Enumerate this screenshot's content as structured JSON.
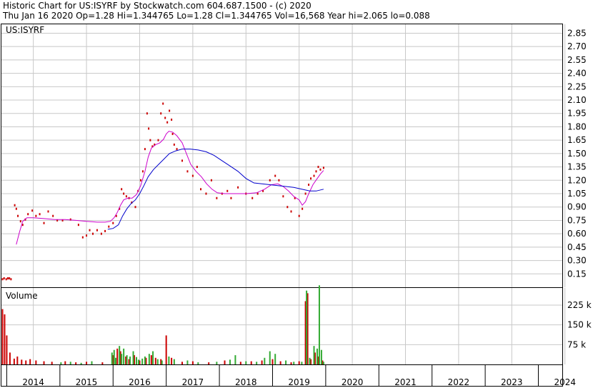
{
  "header": {
    "line1": "Historic Chart for US:ISYRF by Stockwatch.com 604.687.1500 - (c) 2020",
    "line2": "Thu Jan 16 2020  Op=1.28  Hi=1.344765  Lo=1.28  Cl=1.344765  Vol=16,568  Year hi=2.065  lo=0.088"
  },
  "colors": {
    "price": "#cc0000",
    "ma_short": "#cc00cc",
    "ma_long": "#0000cc",
    "vol_up": "#33aa33",
    "vol_down": "#cc0000",
    "grid": "#c8c8c8"
  },
  "chart_data": [
    {
      "type": "line",
      "title": "US:ISYRF",
      "x_tick_labels": [
        "2014",
        "2015",
        "2016",
        "2017",
        "2018",
        "2019",
        "2020",
        "2021",
        "2022",
        "2023",
        "2024"
      ],
      "y_ticks": [
        "0.15",
        "0.30",
        "0.45",
        "0.60",
        "0.75",
        "0.90",
        "1.05",
        "1.20",
        "1.35",
        "1.50",
        "1.65",
        "1.80",
        "1.95",
        "2.10",
        "2.25",
        "2.40",
        "2.55",
        "2.70",
        "2.85"
      ],
      "ylim": [
        0,
        2.95
      ],
      "xlim": [
        2013.9,
        2024.45
      ],
      "grid": true,
      "series": [
        {
          "role": "price",
          "points": [
            [
              2013.92,
              0.09
            ],
            [
              2013.95,
              0.1
            ],
            [
              2013.99,
              0.09
            ],
            [
              2014.02,
              0.1
            ],
            [
              2014.05,
              0.1
            ],
            [
              2014.08,
              0.09
            ],
            [
              2014.15,
              0.92
            ],
            [
              2014.18,
              0.88
            ],
            [
              2014.21,
              0.8
            ],
            [
              2014.26,
              0.74
            ],
            [
              2014.3,
              0.7
            ],
            [
              2014.35,
              0.76
            ],
            [
              2014.4,
              0.82
            ],
            [
              2014.48,
              0.86
            ],
            [
              2014.55,
              0.8
            ],
            [
              2014.62,
              0.82
            ],
            [
              2014.7,
              0.72
            ],
            [
              2014.78,
              0.85
            ],
            [
              2014.87,
              0.8
            ],
            [
              2014.95,
              0.75
            ],
            [
              2015.05,
              0.75
            ],
            [
              2015.2,
              0.76
            ],
            [
              2015.35,
              0.7
            ],
            [
              2015.43,
              0.56
            ],
            [
              2015.5,
              0.58
            ],
            [
              2015.56,
              0.64
            ],
            [
              2015.62,
              0.6
            ],
            [
              2015.7,
              0.64
            ],
            [
              2015.78,
              0.6
            ],
            [
              2015.85,
              0.63
            ],
            [
              2015.92,
              0.68
            ],
            [
              2016.0,
              0.72
            ],
            [
              2016.06,
              0.8
            ],
            [
              2016.12,
              0.88
            ],
            [
              2016.16,
              1.1
            ],
            [
              2016.2,
              1.05
            ],
            [
              2016.25,
              1.02
            ],
            [
              2016.3,
              1.0
            ],
            [
              2016.35,
              0.95
            ],
            [
              2016.42,
              0.9
            ],
            [
              2016.47,
              1.08
            ],
            [
              2016.52,
              1.2
            ],
            [
              2016.56,
              1.3
            ],
            [
              2016.6,
              1.55
            ],
            [
              2016.64,
              1.95
            ],
            [
              2016.67,
              1.78
            ],
            [
              2016.7,
              1.65
            ],
            [
              2016.74,
              1.58
            ],
            [
              2016.78,
              1.6
            ],
            [
              2016.85,
              1.65
            ],
            [
              2016.9,
              1.95
            ],
            [
              2016.94,
              2.06
            ],
            [
              2016.98,
              1.9
            ],
            [
              2017.02,
              1.85
            ],
            [
              2017.06,
              1.98
            ],
            [
              2017.1,
              1.88
            ],
            [
              2017.12,
              1.72
            ],
            [
              2017.15,
              1.6
            ],
            [
              2017.2,
              1.55
            ],
            [
              2017.3,
              1.42
            ],
            [
              2017.4,
              1.3
            ],
            [
              2017.5,
              1.25
            ],
            [
              2017.58,
              1.35
            ],
            [
              2017.65,
              1.1
            ],
            [
              2017.75,
              1.05
            ],
            [
              2017.85,
              1.2
            ],
            [
              2017.95,
              1.0
            ],
            [
              2018.05,
              1.05
            ],
            [
              2018.15,
              1.08
            ],
            [
              2018.22,
              1.0
            ],
            [
              2018.35,
              1.12
            ],
            [
              2018.5,
              1.05
            ],
            [
              2018.62,
              1.0
            ],
            [
              2018.72,
              1.05
            ],
            [
              2018.82,
              1.08
            ],
            [
              2018.95,
              1.2
            ],
            [
              2019.05,
              1.25
            ],
            [
              2019.12,
              1.2
            ],
            [
              2019.2,
              1.02
            ],
            [
              2019.28,
              0.9
            ],
            [
              2019.35,
              0.85
            ],
            [
              2019.42,
              1.0
            ],
            [
              2019.5,
              0.8
            ],
            [
              2019.56,
              0.88
            ],
            [
              2019.62,
              1.05
            ],
            [
              2019.68,
              1.15
            ],
            [
              2019.72,
              1.22
            ],
            [
              2019.78,
              1.25
            ],
            [
              2019.82,
              1.3
            ],
            [
              2019.86,
              1.35
            ],
            [
              2019.9,
              1.32
            ],
            [
              2019.96,
              1.34
            ]
          ]
        },
        {
          "role": "ma_short",
          "points": [
            [
              2014.18,
              0.48
            ],
            [
              2014.24,
              0.62
            ],
            [
              2014.3,
              0.74
            ],
            [
              2014.38,
              0.78
            ],
            [
              2014.5,
              0.78
            ],
            [
              2014.7,
              0.77
            ],
            [
              2014.9,
              0.76
            ],
            [
              2015.1,
              0.76
            ],
            [
              2015.3,
              0.75
            ],
            [
              2015.5,
              0.74
            ],
            [
              2015.7,
              0.73
            ],
            [
              2015.85,
              0.73
            ],
            [
              2015.95,
              0.74
            ],
            [
              2016.02,
              0.78
            ],
            [
              2016.08,
              0.84
            ],
            [
              2016.14,
              0.92
            ],
            [
              2016.2,
              0.98
            ],
            [
              2016.28,
              1.0
            ],
            [
              2016.36,
              1.0
            ],
            [
              2016.44,
              1.04
            ],
            [
              2016.52,
              1.14
            ],
            [
              2016.6,
              1.3
            ],
            [
              2016.66,
              1.46
            ],
            [
              2016.72,
              1.56
            ],
            [
              2016.8,
              1.6
            ],
            [
              2016.88,
              1.62
            ],
            [
              2016.95,
              1.66
            ],
            [
              2017.0,
              1.72
            ],
            [
              2017.05,
              1.75
            ],
            [
              2017.12,
              1.74
            ],
            [
              2017.2,
              1.7
            ],
            [
              2017.3,
              1.62
            ],
            [
              2017.38,
              1.5
            ],
            [
              2017.46,
              1.38
            ],
            [
              2017.56,
              1.3
            ],
            [
              2017.66,
              1.24
            ],
            [
              2017.76,
              1.16
            ],
            [
              2017.86,
              1.1
            ],
            [
              2017.96,
              1.06
            ],
            [
              2018.1,
              1.05
            ],
            [
              2018.3,
              1.05
            ],
            [
              2018.5,
              1.05
            ],
            [
              2018.7,
              1.06
            ],
            [
              2018.85,
              1.1
            ],
            [
              2018.98,
              1.15
            ],
            [
              2019.1,
              1.16
            ],
            [
              2019.2,
              1.13
            ],
            [
              2019.3,
              1.08
            ],
            [
              2019.4,
              1.02
            ],
            [
              2019.5,
              0.98
            ],
            [
              2019.56,
              0.92
            ],
            [
              2019.62,
              0.96
            ],
            [
              2019.68,
              1.05
            ],
            [
              2019.76,
              1.15
            ],
            [
              2019.84,
              1.22
            ],
            [
              2019.9,
              1.27
            ],
            [
              2019.96,
              1.31
            ]
          ]
        },
        {
          "role": "ma_long",
          "points": [
            [
              2015.9,
              0.65
            ],
            [
              2016.0,
              0.66
            ],
            [
              2016.1,
              0.7
            ],
            [
              2016.18,
              0.8
            ],
            [
              2016.26,
              0.88
            ],
            [
              2016.34,
              0.94
            ],
            [
              2016.42,
              0.98
            ],
            [
              2016.5,
              1.05
            ],
            [
              2016.58,
              1.14
            ],
            [
              2016.66,
              1.24
            ],
            [
              2016.76,
              1.32
            ],
            [
              2016.86,
              1.38
            ],
            [
              2016.96,
              1.44
            ],
            [
              2017.06,
              1.5
            ],
            [
              2017.18,
              1.53
            ],
            [
              2017.3,
              1.55
            ],
            [
              2017.45,
              1.55
            ],
            [
              2017.6,
              1.54
            ],
            [
              2017.75,
              1.52
            ],
            [
              2017.9,
              1.48
            ],
            [
              2018.05,
              1.42
            ],
            [
              2018.2,
              1.36
            ],
            [
              2018.35,
              1.3
            ],
            [
              2018.5,
              1.22
            ],
            [
              2018.65,
              1.17
            ],
            [
              2018.8,
              1.16
            ],
            [
              2018.95,
              1.15
            ],
            [
              2019.1,
              1.14
            ],
            [
              2019.25,
              1.13
            ],
            [
              2019.4,
              1.12
            ],
            [
              2019.55,
              1.1
            ],
            [
              2019.7,
              1.08
            ],
            [
              2019.82,
              1.08
            ],
            [
              2019.96,
              1.1
            ]
          ]
        }
      ]
    },
    {
      "type": "bar",
      "title": "Volume",
      "y_ticks": [
        "75 k",
        "150 k",
        "225 k"
      ],
      "ylim": [
        0,
        290
      ],
      "grid": true,
      "up_bars": [
        [
          2015.02,
          8
        ],
        [
          2015.2,
          10
        ],
        [
          2015.4,
          6
        ],
        [
          2015.6,
          12
        ],
        [
          2015.98,
          45
        ],
        [
          2016.02,
          55
        ],
        [
          2016.05,
          25
        ],
        [
          2016.12,
          70
        ],
        [
          2016.16,
          40
        ],
        [
          2016.2,
          60
        ],
        [
          2016.26,
          35
        ],
        [
          2016.32,
          30
        ],
        [
          2016.38,
          50
        ],
        [
          2016.44,
          28
        ],
        [
          2016.48,
          18
        ],
        [
          2016.55,
          22
        ],
        [
          2016.6,
          30
        ],
        [
          2016.68,
          40
        ],
        [
          2016.75,
          50
        ],
        [
          2016.84,
          20
        ],
        [
          2016.92,
          15
        ],
        [
          2017.05,
          30
        ],
        [
          2017.15,
          20
        ],
        [
          2017.4,
          15
        ],
        [
          2017.6,
          8
        ],
        [
          2017.95,
          10
        ],
        [
          2018.2,
          18
        ],
        [
          2018.3,
          35
        ],
        [
          2018.5,
          12
        ],
        [
          2018.7,
          10
        ],
        [
          2018.85,
          25
        ],
        [
          2018.95,
          50
        ],
        [
          2019.05,
          40
        ],
        [
          2019.25,
          15
        ],
        [
          2019.4,
          10
        ],
        [
          2019.55,
          10
        ],
        [
          2019.64,
          280
        ],
        [
          2019.7,
          25
        ],
        [
          2019.78,
          70
        ],
        [
          2019.84,
          60
        ],
        [
          2019.88,
          300
        ],
        [
          2019.92,
          55
        ],
        [
          2019.96,
          10
        ]
      ],
      "down_bars": [
        [
          2013.92,
          210
        ],
        [
          2013.96,
          190
        ],
        [
          2014.0,
          110
        ],
        [
          2014.06,
          45
        ],
        [
          2014.14,
          22
        ],
        [
          2014.2,
          30
        ],
        [
          2014.28,
          18
        ],
        [
          2014.36,
          15
        ],
        [
          2014.44,
          20
        ],
        [
          2014.55,
          15
        ],
        [
          2014.7,
          12
        ],
        [
          2014.85,
          10
        ],
        [
          2015.1,
          12
        ],
        [
          2015.3,
          8
        ],
        [
          2015.5,
          10
        ],
        [
          2015.8,
          8
        ],
        [
          2016.0,
          35
        ],
        [
          2016.08,
          60
        ],
        [
          2016.14,
          50
        ],
        [
          2016.24,
          30
        ],
        [
          2016.3,
          20
        ],
        [
          2016.4,
          35
        ],
        [
          2016.5,
          15
        ],
        [
          2016.62,
          25
        ],
        [
          2016.72,
          35
        ],
        [
          2016.8,
          25
        ],
        [
          2016.9,
          20
        ],
        [
          2017.0,
          110
        ],
        [
          2017.1,
          25
        ],
        [
          2017.3,
          10
        ],
        [
          2017.5,
          12
        ],
        [
          2017.8,
          8
        ],
        [
          2018.1,
          15
        ],
        [
          2018.4,
          10
        ],
        [
          2018.6,
          12
        ],
        [
          2018.8,
          15
        ],
        [
          2019.0,
          20
        ],
        [
          2019.15,
          12
        ],
        [
          2019.35,
          8
        ],
        [
          2019.5,
          12
        ],
        [
          2019.62,
          240
        ],
        [
          2019.66,
          270
        ],
        [
          2019.72,
          20
        ],
        [
          2019.8,
          45
        ],
        [
          2019.86,
          30
        ],
        [
          2019.94,
          15
        ]
      ]
    }
  ]
}
